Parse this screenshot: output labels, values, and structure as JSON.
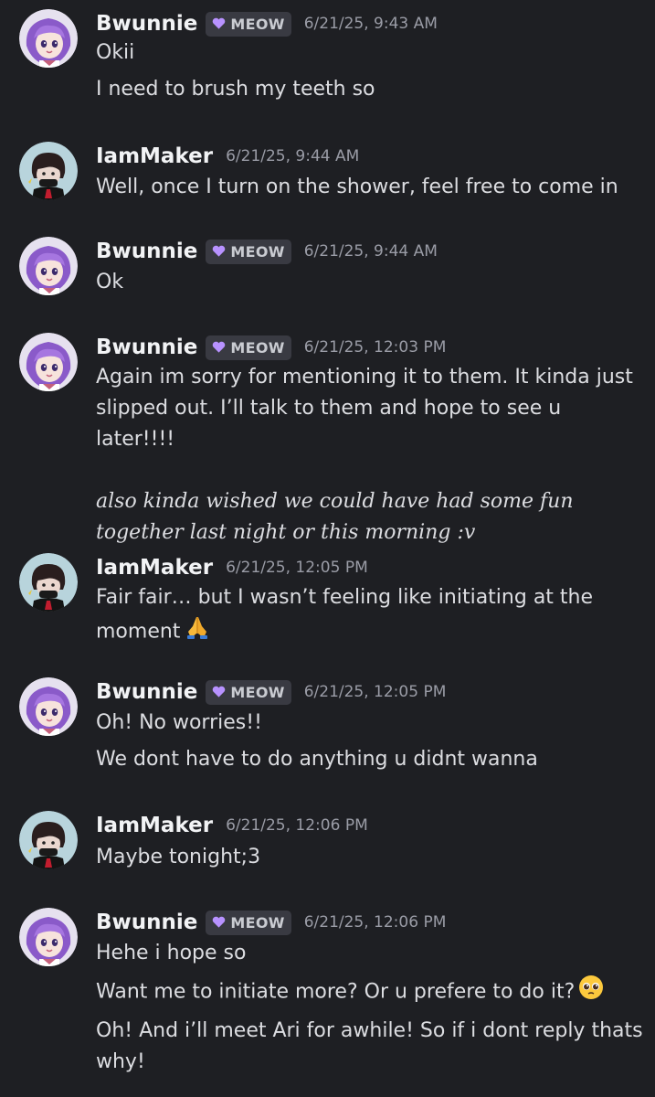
{
  "colors": {
    "background": "#1e1f23",
    "tag_bg": "#393a42",
    "heart": "#b892ff",
    "username": "#f2f3f5",
    "timestamp": "#9a9ca6",
    "text": "#dcdde1"
  },
  "messages": [
    {
      "author": "Bwunnie",
      "tag": "MEOW",
      "timestamp": "6/21/25, 9:43 AM",
      "avatar": "purple-haired-girl-avatar",
      "lines": [
        "Okii",
        "I need to brush my teeth so"
      ]
    },
    {
      "author": "IamMaker",
      "timestamp": "6/21/25, 9:44 AM",
      "avatar": "masked-dark-character-avatar",
      "lines": [
        "Well, once I turn on the shower, feel free to come in"
      ]
    },
    {
      "author": "Bwunnie",
      "tag": "MEOW",
      "timestamp": "6/21/25, 9:44 AM",
      "avatar": "purple-haired-girl-avatar",
      "lines": [
        "Ok"
      ]
    },
    {
      "author": "Bwunnie",
      "tag": "MEOW",
      "timestamp": "6/21/25, 12:03 PM",
      "avatar": "purple-haired-girl-avatar",
      "lines": [
        "Again im sorry for mentioning it to them. It kinda just slipped out. I’ll talk to them and hope to see u later!!!!",
        "also kinda wished we could have had some fun together last night or this morning :v"
      ]
    },
    {
      "author": "IamMaker",
      "timestamp": "6/21/25, 12:05 PM",
      "avatar": "masked-dark-character-avatar",
      "lines": [
        "Fair fair… but I wasn’t feeling like initiating at the moment"
      ],
      "emoji": "folded-hands"
    },
    {
      "author": "Bwunnie",
      "tag": "MEOW",
      "timestamp": "6/21/25, 12:05 PM",
      "avatar": "purple-haired-girl-avatar",
      "lines": [
        "Oh! No worries!!",
        "We dont have to do anything u didnt wanna"
      ]
    },
    {
      "author": "IamMaker",
      "timestamp": "6/21/25, 12:06 PM",
      "avatar": "masked-dark-character-avatar",
      "lines": [
        "Maybe tonight;3"
      ]
    },
    {
      "author": "Bwunnie",
      "tag": "MEOW",
      "timestamp": "6/21/25, 12:06 PM",
      "avatar": "purple-haired-girl-avatar",
      "lines": [
        "Hehe i hope so",
        "Want me to initiate more? Or u prefere to do it?",
        "Oh! And i’ll meet Ari for awhile! So if i dont reply thats why!"
      ],
      "emoji": "pleading-face"
    }
  ]
}
